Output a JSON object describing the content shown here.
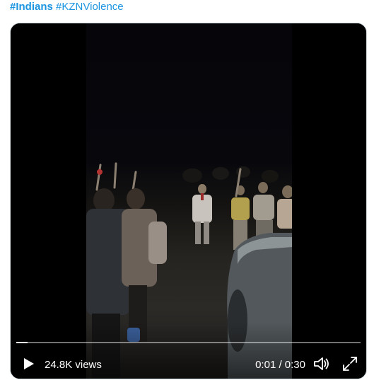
{
  "tweet": {
    "hashtags": [
      "#Indians",
      "#KZNViolence"
    ]
  },
  "video": {
    "views_label": "24.8K views",
    "time_display": "0:01 / 0:30",
    "progress_fraction": 0.033,
    "controls": {
      "play_icon": "play-icon",
      "volume_icon": "volume-icon",
      "fullscreen_icon": "fullscreen-icon"
    }
  }
}
